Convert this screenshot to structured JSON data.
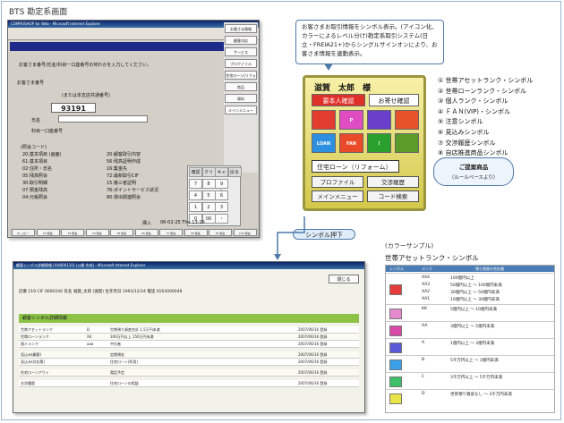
{
  "heading": "BTS 勘定系画面",
  "screen1": {
    "title": "COMPOSHOP for Web - Microsoft Internet Explorer",
    "prompt": "お客さま番号/氏名/科目一口座番号の何れかを入力してください。",
    "customer_no_label": "お客さま番号",
    "customer_no": "93191",
    "customer_note": "(または本支店共通番号)",
    "name_label": "氏名",
    "kamoku_label": "科目一口座番号",
    "sidebar": [
      "お客さま情報",
      "顧客対応",
      "サービス",
      "プロファイル",
      "住宅ローン(リフォーム)",
      "商品",
      "資料",
      "メインメニュー"
    ],
    "codes_title": "(照会コード)",
    "codes_left": [
      "20:基本項目 (画面)",
      "61:基本項目",
      "02:住所・氏名",
      "05:残高照会",
      "30:取引明細",
      "07:預金残高",
      "04:元帳照会"
    ],
    "codes_right": [
      "20:顧客取引内容",
      "56:残高証明作成",
      "16:集金先",
      "72:最新取引CIF",
      "15:第三者証明",
      "76:ポイントサービス状況",
      "80:貸出関連照会"
    ],
    "keypad_head": [
      "確認",
      "クリア",
      "キャンセル",
      "戻る"
    ],
    "keys": [
      "7",
      "8",
      "9",
      "4",
      "5",
      "6",
      "1",
      "2",
      "3",
      "0",
      "00",
      "・"
    ],
    "input_label": "挿入",
    "datetime": "06-02-25 Thu 13:10",
    "bottom_buttons": [
      "F1 コピー",
      "F2 照会",
      "F3 照会",
      "F4 照会",
      "F5 照会",
      "F6 照会",
      "F7 照会",
      "F8 照会",
      "F9 照会",
      "F10 照会"
    ]
  },
  "callout": "お客さまお取引情報をシンボル表示。(アイコン化、カラーによるレベル分け)勘定系取引システム(日立・FREIA21+)からシングルサインオンにより、お客さま情報を連動表示。",
  "panel": {
    "name": "滋賀　太郎　様",
    "req_label": "要本人確認",
    "deposit_label": "お寄せ確認",
    "icons": [
      {
        "name": "person-icon",
        "label": "",
        "color": "#e23b2f"
      },
      {
        "name": "points-icon",
        "label": "P",
        "color": "#e04dc3"
      },
      {
        "name": "card-icon",
        "label": "",
        "color": "#6a3fc9"
      },
      {
        "name": "fan-icon",
        "label": "",
        "color": "#e8522b"
      },
      {
        "name": "house-icon",
        "label": "LOAN",
        "color": "#2d8fe0"
      },
      {
        "name": "fan-vip-icon",
        "label": "FAN",
        "color": "#e94a2a"
      },
      {
        "name": "exclamation-icon",
        "label": "!",
        "color": "#2aa12f"
      },
      {
        "name": "people-icon",
        "label": "",
        "color": "#5b9b2a"
      }
    ],
    "product": "住宅ローン（リフォーム）",
    "buttons": [
      "プロファイル",
      "交渉履歴",
      "メインメニュー",
      "コード検索"
    ]
  },
  "legend": [
    "① 世帯アセットランク・シンボル",
    "② 世帯ローンランク・シンボル",
    "③ 個人ランク・シンボル",
    "④ ＦＡＮ(VIP)・シンボル",
    "⑤ 注意シンボル",
    "⑥ 見込みシンボル",
    "⑦ 交渉履歴シンボル",
    "⑧ 自店推進商品シンボル"
  ],
  "bubble": [
    "ご提案商品",
    "（ルールベースより）"
  ],
  "push_label": "シンボル押下",
  "screen2": {
    "title": "顧客シンボル詳細情報 [XH000110] (公開 作成) - Microsoft Internet Explorer",
    "close": "閉じる",
    "info": "店番 119  CIF 0000240  氏名 滋賀_太郎  (滋賀)  生年月日 1993/12/24  電話 0163000048",
    "section": "顧客シンボル詳細情報",
    "rows": [
      [
        "世帯アセットランク",
        "D",
        "世帯預り資産合計 1,5万円未満",
        "2007/06/16 登録"
      ],
      [
        "世帯ローンランク",
        "X4",
        "100万円以上 150万円未満",
        "2007/06/16 登録"
      ],
      [
        "個人ランク",
        "aaa",
        "中位者",
        "2007/06/16 登録"
      ],
      [
        "見込み(顧客)",
        "",
        "定期預金",
        "2007/06/16 登録"
      ],
      [
        "見込み(対応策)",
        "",
        "住宅ローン(利用)",
        "2007/06/16 登録"
      ],
      [
        "住宅ローンアウト",
        "",
        "電話予定",
        "2007/06/16 登録"
      ],
      [
        "交渉履歴",
        "",
        "住宅ローンの相談",
        "2007/06/16 登録"
      ]
    ]
  },
  "color_sample": {
    "subtitle": "(カラーサンプル)",
    "title": "世帯アセットランク・シンボル",
    "header": [
      "シンボル",
      "ランク",
      "預り資産の合計額"
    ],
    "rows": [
      {
        "color": "#e63c3c",
        "ranks": [
          "XA4",
          "XA3",
          "XA2",
          "XA1"
        ],
        "vals": [
          "100億円以上",
          "50億円以上 ～ 100億円未満",
          "30億円以上 ～ 50億円未満",
          "10億円以上 ～ 30億円未満"
        ]
      },
      {
        "color": "#e68ad0",
        "ranks": [
          "KK"
        ],
        "vals": [
          "5億円以上 ～ 10億円未満"
        ]
      },
      {
        "color": "#d94aa8",
        "ranks": [
          "AA"
        ],
        "vals": [
          "3億円以上 ～ 5億円未満"
        ]
      },
      {
        "color": "#5a5ad8",
        "ranks": [
          "A"
        ],
        "vals": [
          "1億円以上 ～ 3億円未満"
        ]
      },
      {
        "color": "#3aa0e8",
        "ranks": [
          "B"
        ],
        "vals": [
          "5千万円以上 ～ 1億円未満"
        ]
      },
      {
        "color": "#3cc06a",
        "ranks": [
          "C"
        ],
        "vals": [
          "3千万円以上 ～ 5千万円未満"
        ]
      },
      {
        "color": "#e9e44a",
        "ranks": [
          "D"
        ],
        "vals": [
          "世帯預り資産なし ～ 3千万円未満"
        ]
      }
    ]
  }
}
